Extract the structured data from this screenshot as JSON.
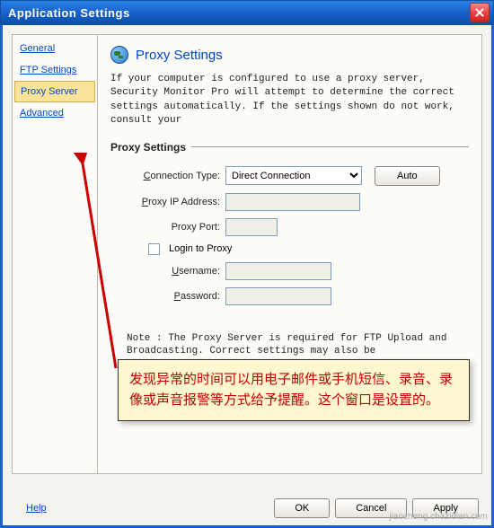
{
  "title": "Application Settings",
  "sidebar": {
    "items": [
      {
        "label": "General"
      },
      {
        "label": "FTP Settings"
      },
      {
        "label": "Proxy Server"
      },
      {
        "label": "Advanced"
      }
    ]
  },
  "main": {
    "header": "Proxy Settings",
    "description": "If your computer is configured to use a proxy server, Security Monitor Pro will attempt to determine the correct settings automatically. If the settings shown do not work, consult your",
    "section_title": "Proxy Settings",
    "conn_label_pre": "C",
    "conn_label_post": "onnection Type:",
    "conn_value": "Direct Connection",
    "auto_label_pre": "A",
    "auto_label_post": "uto",
    "ip_label_pre": "P",
    "ip_label_post": "roxy IP Address:",
    "port_label": "Proxy Port:",
    "login_label_pre": "L",
    "login_label_post": "ogin to Proxy",
    "user_label_pre": "U",
    "user_label_post": "sername:",
    "pass_label_pre": "P",
    "pass_label_post": "assword:",
    "note": "Note : The Proxy Server is required for FTP Upload and Broadcasting. Correct settings may also be"
  },
  "bottom": {
    "help_pre": "H",
    "help_post": "elp",
    "ok": "OK",
    "cancel": "Cancel",
    "apply_pre": "A",
    "apply_post": "pply"
  },
  "callout": {
    "text": "发现异常的时间可以用电子邮件或手机短信、录音、录像或声音报警等方式给予提醒。这个窗口是设置的。"
  },
  "watermark": "jiaocheng.chazidian.com"
}
